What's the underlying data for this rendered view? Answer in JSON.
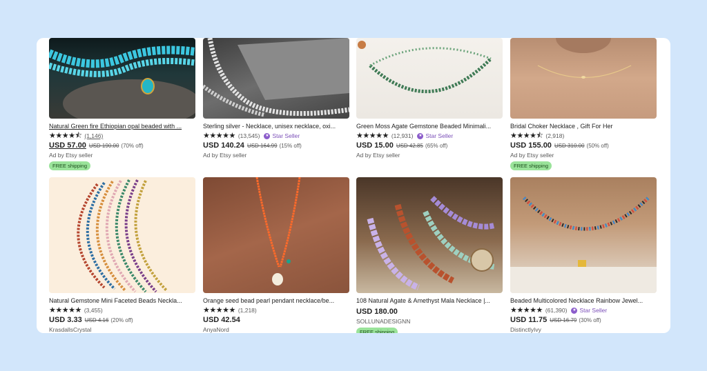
{
  "listings": [
    {
      "title": "Natural Green fire Ethiopian opal beaded with ...",
      "stars": "★★★★⯪",
      "reviews": "(1,146)",
      "star_seller": "",
      "price": "USD 57.00",
      "original": "USD 190.00",
      "discount": "(70% off)",
      "meta": "Ad by Etsy seller",
      "shipping": "FREE shipping"
    },
    {
      "title": "Sterling silver - Necklace, unisex necklace, oxi...",
      "stars": "★★★★★",
      "reviews": "(13,545)",
      "star_seller": "Star Seller",
      "price": "USD 140.24",
      "original": "USD 164.99",
      "discount": "(15% off)",
      "meta": "Ad by Etsy seller",
      "shipping": ""
    },
    {
      "title": "Green Moss Agate Gemstone Beaded Minimali...",
      "stars": "★★★★★",
      "reviews": "(12,931)",
      "star_seller": "Star Seller",
      "price": "USD 15.00",
      "original": "USD 42.85",
      "discount": "(65% off)",
      "meta": "Ad by Etsy seller",
      "shipping": ""
    },
    {
      "title": "Bridal Choker Necklace , Gift For Her",
      "stars": "★★★★⯪",
      "reviews": "(2,918)",
      "star_seller": "",
      "price": "USD 155.00",
      "original": "USD 310.00",
      "discount": "(50% off)",
      "meta": "Ad by Etsy seller",
      "shipping": "FREE shipping"
    },
    {
      "title": "Natural Gemstone Mini Faceted Beads Neckla...",
      "stars": "★★★★★",
      "reviews": "(3,455)",
      "star_seller": "",
      "price": "USD 3.33",
      "original": "USD 4.16",
      "discount": "(20% off)",
      "meta": "KrasdallsCrystal",
      "shipping": ""
    },
    {
      "title": "Orange seed bead pearl pendant necklace/be...",
      "stars": "★★★★★",
      "reviews": "(1,218)",
      "star_seller": "",
      "price": "USD 42.54",
      "original": "",
      "discount": "",
      "meta": "AnyaNord",
      "shipping": ""
    },
    {
      "title": "108 Natural Agate & Amethyst Mala Necklace |...",
      "stars": "",
      "reviews": "",
      "star_seller": "",
      "price": "USD 180.00",
      "original": "",
      "discount": "",
      "meta": "SOLLUNADESIGNN",
      "shipping": "FREE shipping"
    },
    {
      "title": "Beaded Multicolored Necklace Rainbow Jewel...",
      "stars": "★★★★★",
      "reviews": "(61,390)",
      "star_seller": "Star Seller",
      "price": "USD 11.75",
      "original": "USD 16.79",
      "discount": "(30% off)",
      "meta": "DistinctlyIvy",
      "shipping": ""
    }
  ],
  "colors": {
    "background": "#d2e6fb",
    "star_seller": "#7b4fb8",
    "free_shipping": "#9ae39a"
  }
}
